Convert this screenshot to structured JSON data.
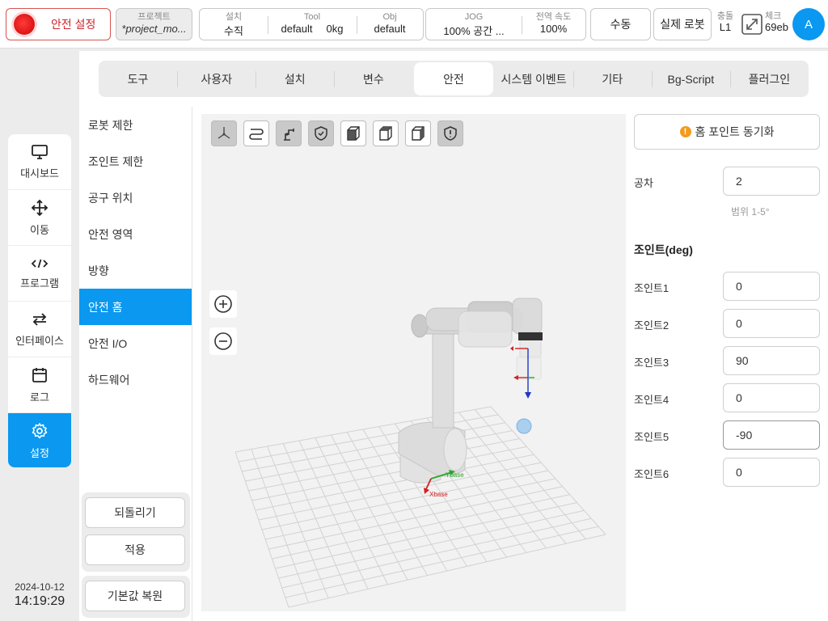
{
  "topbar": {
    "safety_label": "안전 설정",
    "project_caption": "프로젝트",
    "project_name": "*project_mo...",
    "install": {
      "caption": "설치",
      "value": "수직"
    },
    "tool": {
      "caption": "Tool",
      "value": "default",
      "payload": "0kg"
    },
    "obj": {
      "caption": "Obj",
      "value": "default"
    },
    "jog": {
      "caption": "JOG",
      "value": "100%  공간 ..."
    },
    "global_speed": {
      "caption": "전역 속도",
      "value": "100%"
    },
    "mode_label": "수동",
    "robot_label": "실제 로봇",
    "collision": {
      "caption": "충돌",
      "value": "L1"
    },
    "check": {
      "caption": "체크",
      "value": "69eb"
    },
    "avatar_letter": "A"
  },
  "leftnav": {
    "items": [
      {
        "label": "대시보드",
        "icon": "monitor-icon"
      },
      {
        "label": "이동",
        "icon": "move-icon"
      },
      {
        "label": "프로그램",
        "icon": "code-icon"
      },
      {
        "label": "인터페이스",
        "icon": "swap-icon"
      },
      {
        "label": "로그",
        "icon": "calendar-icon"
      },
      {
        "label": "설정",
        "icon": "gear-icon"
      }
    ],
    "active_index": 5
  },
  "datetime": {
    "date": "2024-10-12",
    "time": "14:19:29"
  },
  "tabs": [
    "도구",
    "사용자",
    "설치",
    "변수",
    "안전",
    "시스템 이벤트",
    "기타",
    "Bg-Script",
    "플러그인"
  ],
  "active_tab": 4,
  "sublist": {
    "items": [
      "로봇 제한",
      "조인트 제한",
      "공구 위치",
      "안전 영역",
      "방향",
      "안전 홈",
      "안전 I/O",
      "하드웨어"
    ],
    "active_index": 5,
    "revert_label": "되돌리기",
    "apply_label": "적용",
    "reset_label": "기본값 복원"
  },
  "viewport": {
    "base_x_label": "Xbase",
    "base_y_label": "Ybase"
  },
  "rightpanel": {
    "sync_label": "홈 포인트 동기화",
    "tolerance_label": "공차",
    "tolerance_value": "2",
    "tolerance_hint": "범위 1-5°",
    "joints_title": "조인트(deg)",
    "joints": [
      {
        "label": "조인트1",
        "value": "0"
      },
      {
        "label": "조인트2",
        "value": "0"
      },
      {
        "label": "조인트3",
        "value": "90"
      },
      {
        "label": "조인트4",
        "value": "0"
      },
      {
        "label": "조인트5",
        "value": "-90"
      },
      {
        "label": "조인트6",
        "value": "0"
      }
    ]
  },
  "colors": {
    "accent": "#0a98f0",
    "danger": "#d0252a",
    "warning": "#f39a1e"
  }
}
